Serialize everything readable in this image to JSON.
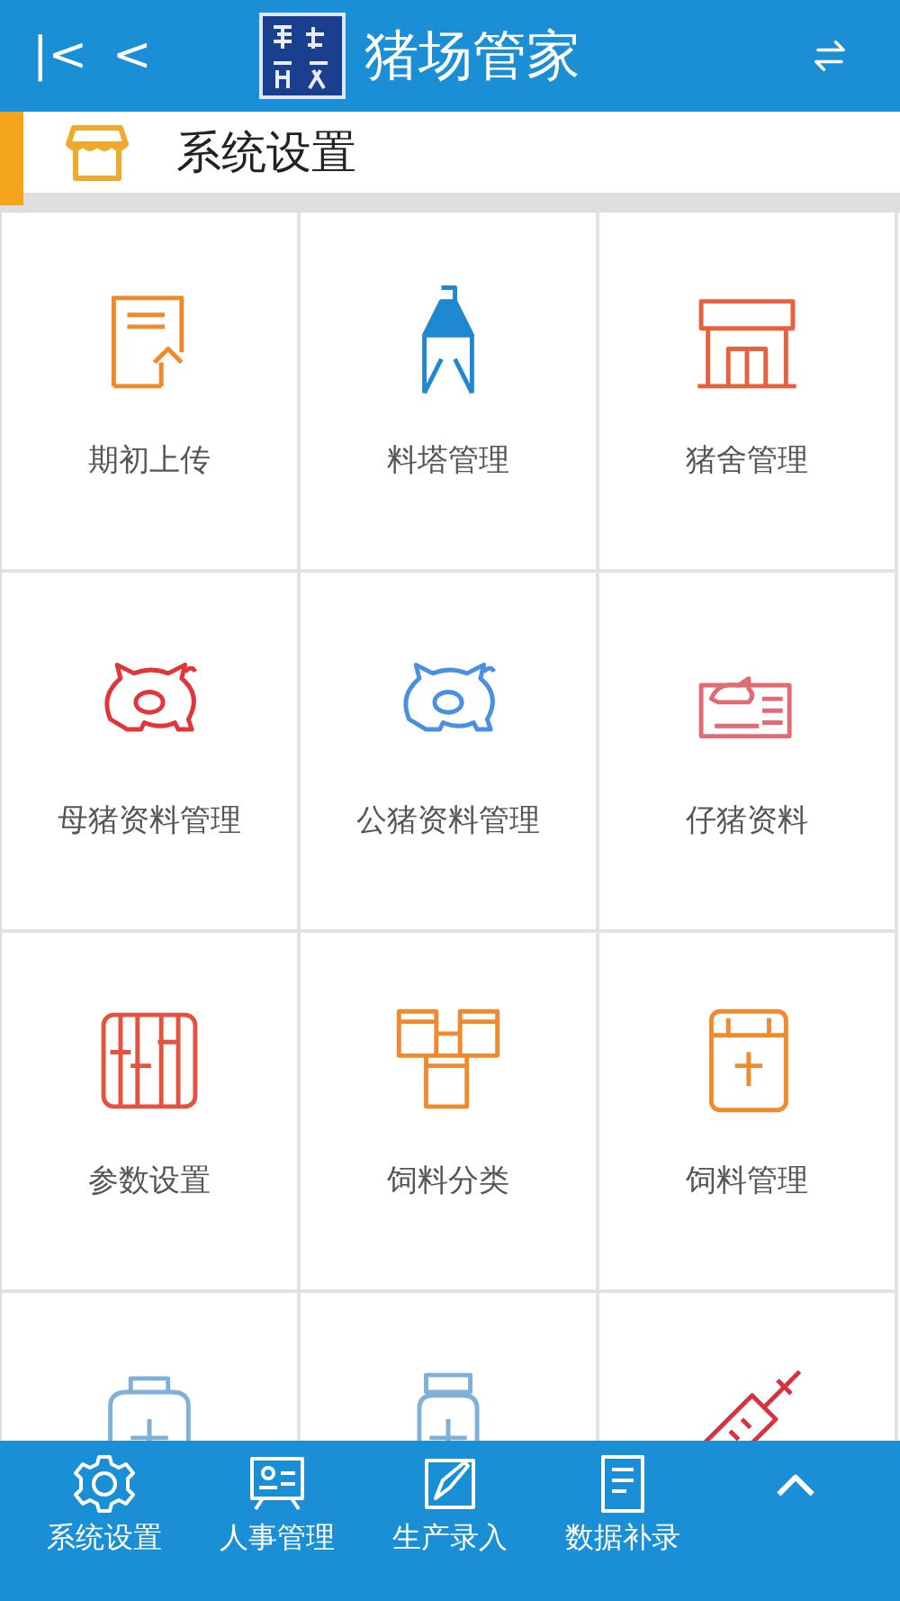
{
  "header": {
    "title": "猪场管家",
    "back_labels": [
      "|<",
      "<"
    ]
  },
  "section": {
    "title": "系统设置"
  },
  "tiles": [
    {
      "label": "期初上传",
      "kind": "upload",
      "color": "#f0892a"
    },
    {
      "label": "料塔管理",
      "kind": "silo",
      "color": "#1e88d0"
    },
    {
      "label": "猪舍管理",
      "kind": "barn",
      "color": "#e8603c"
    },
    {
      "label": "母猪资料管理",
      "kind": "pig",
      "color": "#e3343a"
    },
    {
      "label": "公猪资料管理",
      "kind": "pig",
      "color": "#4a8fe0"
    },
    {
      "label": "仔猪资料",
      "kind": "card",
      "color": "#e06b75"
    },
    {
      "label": "参数设置",
      "kind": "abacus",
      "color": "#e4533f"
    },
    {
      "label": "饲料分类",
      "kind": "bags",
      "color": "#f08a2c"
    },
    {
      "label": "饲料管理",
      "kind": "bag",
      "color": "#f08a2c"
    },
    {
      "kind": "kit",
      "color": "#7fb0d8"
    },
    {
      "kind": "jar",
      "color": "#7fb0d8"
    },
    {
      "kind": "syringe",
      "color": "#d7323f"
    }
  ],
  "nav": [
    {
      "label": "系统设置",
      "kind": "gear"
    },
    {
      "label": "人事管理",
      "kind": "board"
    },
    {
      "label": "生产录入",
      "kind": "pen"
    },
    {
      "label": "数据补录",
      "kind": "clipboard"
    },
    {
      "kind": "up"
    }
  ]
}
